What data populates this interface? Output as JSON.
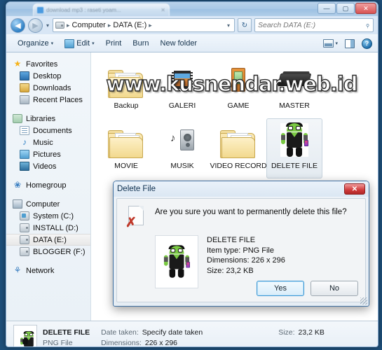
{
  "window": {
    "browser_tab_title": "download mp3 : raseti yoam...",
    "minimize": "—",
    "maximize": "▢",
    "close": "✕"
  },
  "address": {
    "back_icon": "◀",
    "forward_icon": "▶",
    "history_caret": "▾",
    "crumbs": [
      "Computer",
      "DATA (E:)"
    ],
    "separator": "▸",
    "dropdown_caret": "▾",
    "refresh_icon": "↻"
  },
  "search": {
    "placeholder": "Search DATA (E:)",
    "value": "",
    "icon": "search-icon"
  },
  "toolbar": {
    "organize": "Organize",
    "edit": "Edit",
    "print": "Print",
    "burn": "Burn",
    "new_folder": "New folder",
    "caret": "▾",
    "help": "?"
  },
  "sidebar": {
    "groups": [
      {
        "header": "Favorites",
        "icon": "star-icon",
        "items": [
          {
            "label": "Desktop",
            "icon": "desktop-icon"
          },
          {
            "label": "Downloads",
            "icon": "downloads-icon"
          },
          {
            "label": "Recent Places",
            "icon": "recent-places-icon"
          }
        ]
      },
      {
        "header": "Libraries",
        "icon": "library-icon",
        "items": [
          {
            "label": "Documents",
            "icon": "documents-icon"
          },
          {
            "label": "Music",
            "icon": "music-icon"
          },
          {
            "label": "Pictures",
            "icon": "pictures-icon"
          },
          {
            "label": "Videos",
            "icon": "videos-icon"
          }
        ]
      },
      {
        "header": "Homegroup",
        "icon": "homegroup-icon",
        "items": []
      },
      {
        "header": "Computer",
        "icon": "computer-icon",
        "items": [
          {
            "label": "System (C:)",
            "icon": "system-drive-icon",
            "selected": false
          },
          {
            "label": "INSTALL (D:)",
            "icon": "drive-icon",
            "selected": false
          },
          {
            "label": "DATA (E:)",
            "icon": "drive-icon",
            "selected": true
          },
          {
            "label": "BLOGGER (F:)",
            "icon": "drive-icon",
            "selected": false
          }
        ]
      },
      {
        "header": "Network",
        "icon": "network-icon",
        "items": []
      }
    ]
  },
  "content": {
    "watermark": "www.kusnendar.web.id",
    "items": [
      {
        "label": "Backup",
        "icon": "folder-icon",
        "selected": false
      },
      {
        "label": "GALERI",
        "icon": "filmstrip-icon",
        "selected": false
      },
      {
        "label": "GAME",
        "icon": "cartridge-icon",
        "selected": false
      },
      {
        "label": "MASTER",
        "icon": "device-icon",
        "selected": false
      },
      {
        "label": "MOVIE",
        "icon": "folder-icon",
        "selected": false
      },
      {
        "label": "MUSIK",
        "icon": "speaker-icon",
        "selected": false
      },
      {
        "label": "VIDEO RECORD",
        "icon": "folder-icon",
        "selected": false
      },
      {
        "label": "DELETE FILE",
        "icon": "android-icon",
        "selected": true
      }
    ]
  },
  "dialog": {
    "title": "Delete File",
    "close": "✕",
    "icon": "delete-file-icon",
    "question": "Are you sure you want to permanently delete this file?",
    "file": {
      "name": "DELETE FILE",
      "item_type": "Item type: PNG File",
      "dimensions": "Dimensions: 226 x 296",
      "size": "Size: 23,2 KB"
    },
    "yes": "Yes",
    "no": "No"
  },
  "statusbar": {
    "name": "DELETE FILE",
    "type": "PNG File",
    "date_taken_label": "Date taken:",
    "date_taken_value": "Specify date taken",
    "dimensions_label": "Dimensions:",
    "dimensions_value": "226 x 296",
    "size_label": "Size:",
    "size_value": "23,2 KB"
  }
}
